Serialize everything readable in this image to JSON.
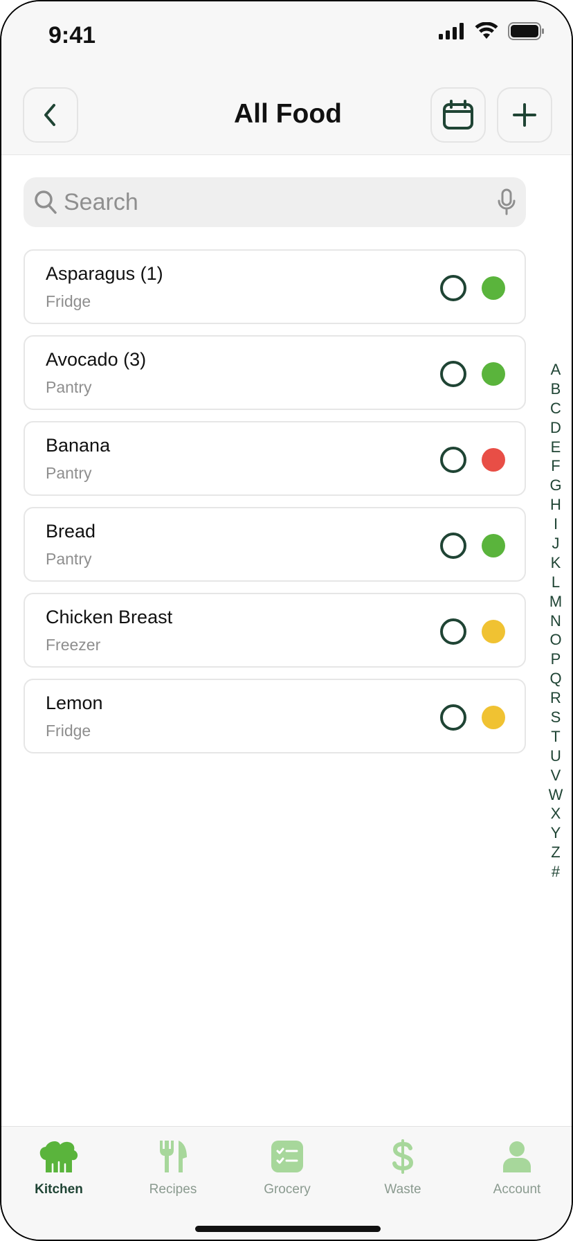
{
  "status_bar": {
    "time": "9:41"
  },
  "header": {
    "title": "All Food"
  },
  "search": {
    "placeholder": "Search",
    "value": ""
  },
  "colors": {
    "accent": "#1f4434",
    "fresh": "#5ab43c",
    "expired": "#e84e46",
    "expiring": "#f0c232",
    "tab_inactive": "#a7d79b"
  },
  "items": [
    {
      "name": "Asparagus (1)",
      "location": "Fridge",
      "status": "fresh",
      "status_color": "#5ab43c"
    },
    {
      "name": "Avocado (3)",
      "location": "Pantry",
      "status": "fresh",
      "status_color": "#5ab43c"
    },
    {
      "name": "Banana",
      "location": "Pantry",
      "status": "expired",
      "status_color": "#e84e46"
    },
    {
      "name": "Bread",
      "location": "Pantry",
      "status": "fresh",
      "status_color": "#5ab43c"
    },
    {
      "name": "Chicken Breast",
      "location": "Freezer",
      "status": "expiring",
      "status_color": "#f0c232"
    },
    {
      "name": "Lemon",
      "location": "Fridge",
      "status": "expiring",
      "status_color": "#f0c232"
    }
  ],
  "alphabet": [
    "A",
    "B",
    "C",
    "D",
    "E",
    "F",
    "G",
    "H",
    "I",
    "J",
    "K",
    "L",
    "M",
    "N",
    "O",
    "P",
    "Q",
    "R",
    "S",
    "T",
    "U",
    "V",
    "W",
    "X",
    "Y",
    "Z",
    "#"
  ],
  "tabs": [
    {
      "label": "Kitchen",
      "icon": "chef-hat-icon",
      "active": true
    },
    {
      "label": "Recipes",
      "icon": "fork-knife-icon",
      "active": false
    },
    {
      "label": "Grocery",
      "icon": "checklist-icon",
      "active": false
    },
    {
      "label": "Waste",
      "icon": "dollar-icon",
      "active": false
    },
    {
      "label": "Account",
      "icon": "person-icon",
      "active": false
    }
  ]
}
